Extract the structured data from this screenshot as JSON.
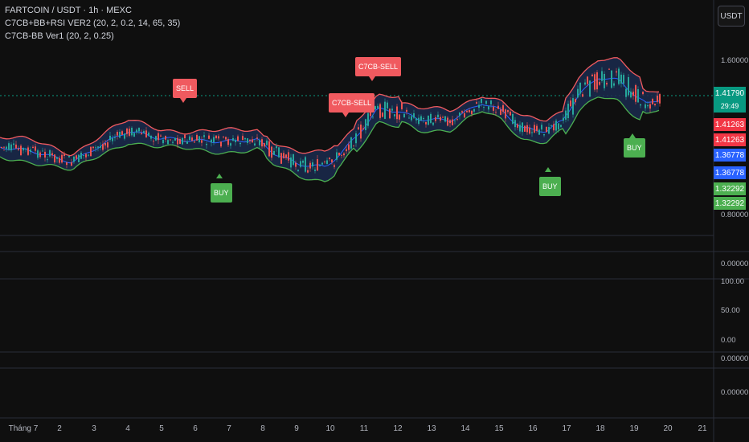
{
  "legend": {
    "symbol_line": "FARTCOIN / USDT · 1h · MEXC",
    "indicator_1": "C7CB+BB+RSI VER2 (20, 2, 0.2, 14, 65, 35)",
    "indicator_2": "C7CB-BB Ver1 (20, 2, 0.25)"
  },
  "currency_button": "USDT",
  "price_axis": {
    "main": [
      "1.60000",
      "0.80000"
    ],
    "pane2": [
      "0.00000"
    ],
    "rsi": [
      "100.00",
      "50.00",
      "0.00"
    ],
    "pane4": [
      "0.00000",
      "0.00000"
    ]
  },
  "price_labels": {
    "last": "1.41790",
    "countdown": "29:49",
    "upper_a": "1.41263",
    "upper_b": "1.41263",
    "mid_a": "1.36778",
    "mid_b": "1.36778",
    "lower_a": "1.32292",
    "lower_b": "1.32292"
  },
  "signals": {
    "sell_1": "SELL",
    "sell_2": "C7CB-SELL",
    "sell_3": "C7CB-SELL",
    "buy_1": "BUY",
    "buy_2": "BUY",
    "buy_3": "BUY"
  },
  "time_axis": [
    "Tháng 7",
    "2",
    "3",
    "4",
    "5",
    "6",
    "7",
    "8",
    "9",
    "10",
    "11",
    "12",
    "13",
    "14",
    "15",
    "16",
    "17",
    "18",
    "19",
    "20",
    "21"
  ],
  "colors": {
    "background": "#0f0f0f",
    "upper_band": "#f05a5f",
    "lower_band": "#4caf50",
    "basis": "#2962ff",
    "sell": "#f23645",
    "buy": "#4caf50",
    "last_price": "#089981",
    "band_fill": "#1a2a4d"
  }
}
